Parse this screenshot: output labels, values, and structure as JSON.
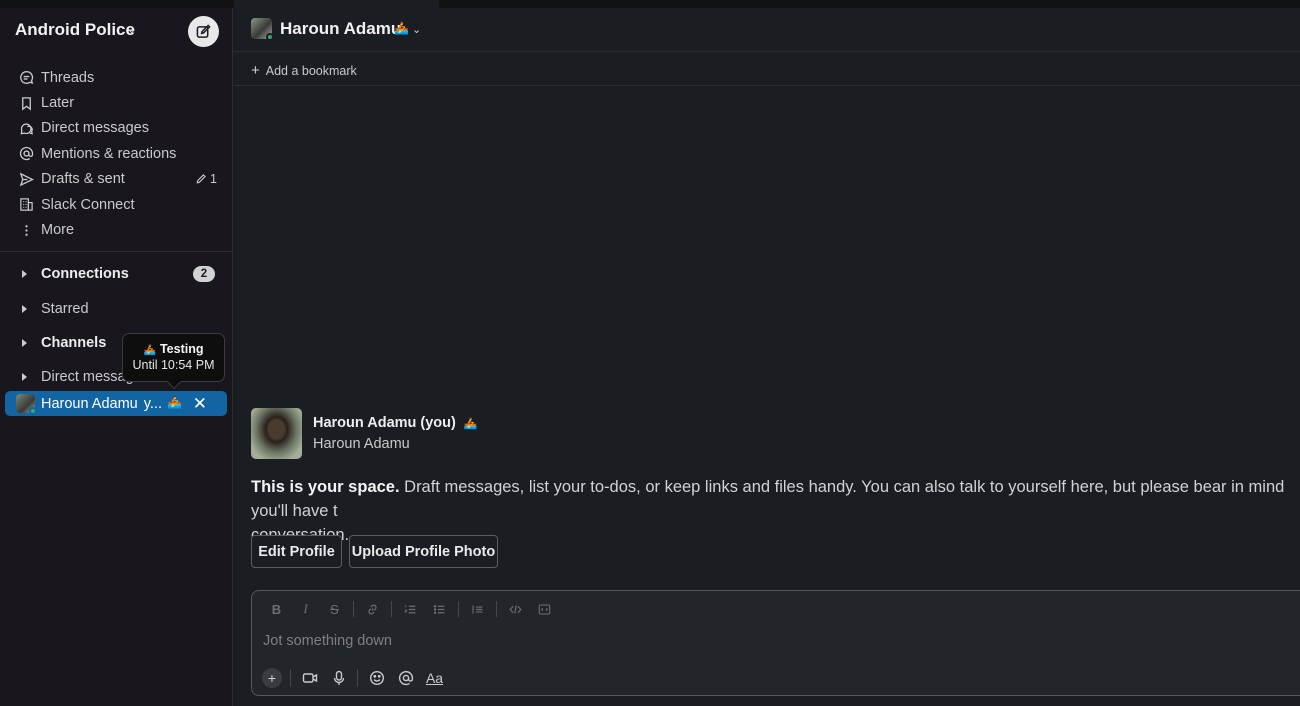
{
  "workspace": {
    "name": "Android Police"
  },
  "sidebar": {
    "nav": [
      {
        "label": "Threads",
        "icon": "threads-icon"
      },
      {
        "label": "Later",
        "icon": "bookmark-icon"
      },
      {
        "label": "Direct messages",
        "icon": "direct-messages-icon"
      },
      {
        "label": "Mentions & reactions",
        "icon": "at-icon"
      },
      {
        "label": "Drafts & sent",
        "icon": "send-icon",
        "count": "1"
      },
      {
        "label": "Slack Connect",
        "icon": "building-icon"
      },
      {
        "label": "More",
        "icon": "more-vertical-icon"
      }
    ],
    "sections": {
      "connections": {
        "label": "Connections",
        "badge": "2"
      },
      "starred": {
        "label": "Starred"
      },
      "channels": {
        "label": "Channels"
      },
      "direct_messages": {
        "label": "Direct messag"
      }
    },
    "active_dm": {
      "label": "Haroun Adamu",
      "suffix": "y..."
    },
    "tooltip": {
      "status": "Testing",
      "until": "Until 10:54 PM"
    }
  },
  "channel": {
    "name": "Haroun Adamu",
    "bookmark_label": "Add a bookmark"
  },
  "intro": {
    "name": "Haroun Adamu (you)",
    "subname": "Haroun Adamu",
    "lead": "This is your space.",
    "body": " Draft messages, list your to-dos, or keep links and files handy. You can also talk to yourself here, but please bear in mind you'll have t",
    "body2": "conversation.",
    "edit_profile": "Edit Profile",
    "upload_photo": "Upload Profile Photo"
  },
  "composer": {
    "placeholder": "Jot something down",
    "aa_label": "Aa"
  },
  "colors": {
    "active": "#1264a3",
    "presence": "#2bac76",
    "sidebar_bg": "#19171d",
    "main_bg": "#1a1d21"
  }
}
